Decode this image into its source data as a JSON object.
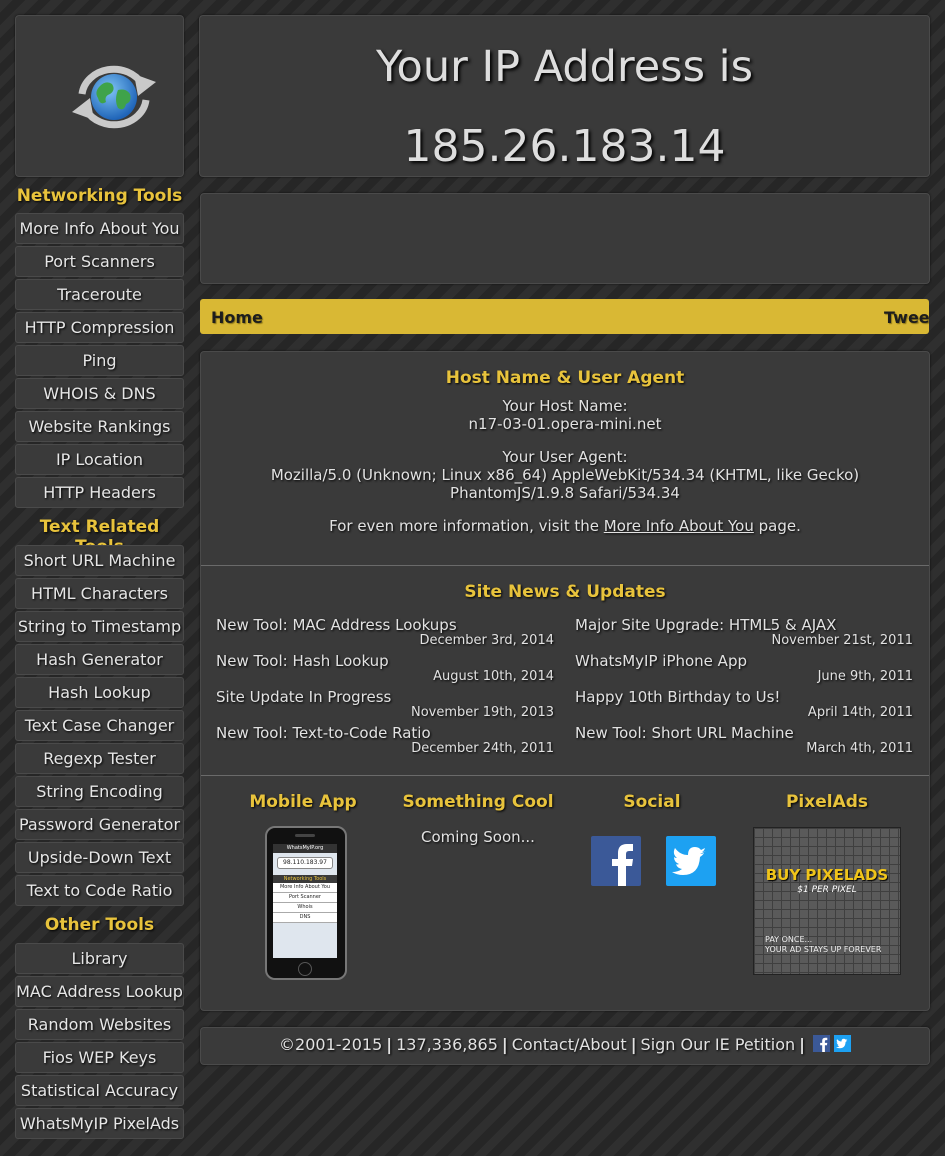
{
  "header": {
    "ip_title": "Your IP Address is",
    "ip_address": "185.26.183.14"
  },
  "sidebar": {
    "sections": [
      {
        "heading": "Networking Tools",
        "items": [
          "More Info About You",
          "Port Scanners",
          "Traceroute",
          "HTTP Compression",
          "Ping",
          "WHOIS & DNS",
          "Website Rankings",
          "IP Location",
          "HTTP Headers"
        ]
      },
      {
        "heading": "Text Related Tools",
        "items": [
          "Short URL Machine",
          "HTML Characters",
          "String to Timestamp",
          "Hash Generator",
          "Hash Lookup",
          "Text Case Changer",
          "Regexp Tester",
          "String Encoding",
          "Password Generator",
          "Upside-Down Text",
          "Text to Code Ratio"
        ]
      },
      {
        "heading": "Other Tools",
        "items": [
          "Library",
          "MAC Address Lookup",
          "Random Websites",
          "Fios WEP Keys",
          "Statistical Accuracy",
          "WhatsMyIP PixelAds"
        ]
      }
    ]
  },
  "nav": {
    "home": "Home",
    "tweet": "Tweet"
  },
  "host": {
    "title": "Host Name & User Agent",
    "host_label": "Your Host Name:",
    "host_value": "n17-03-01.opera-mini.net",
    "ua_label": "Your User Agent:",
    "ua_line1": "Mozilla/5.0 (Unknown; Linux x86_64) AppleWebKit/534.34 (KHTML, like Gecko)",
    "ua_line2": "PhantomJS/1.9.8 Safari/534.34",
    "more_prefix": "For even more information, visit the",
    "more_link": "More Info About You",
    "more_suffix": "page."
  },
  "news": {
    "title": "Site News & Updates",
    "left": [
      {
        "title": "New Tool: MAC Address Lookups",
        "date": "December 3rd, 2014"
      },
      {
        "title": "New Tool: Hash Lookup",
        "date": "August 10th, 2014"
      },
      {
        "title": "Site Update In Progress",
        "date": "November 19th, 2013"
      },
      {
        "title": "New Tool: Text-to-Code Ratio",
        "date": "December 24th, 2011"
      }
    ],
    "right": [
      {
        "title": "Major Site Upgrade: HTML5 & AJAX",
        "date": "November 21st, 2011"
      },
      {
        "title": "WhatsMyIP iPhone App",
        "date": "June 9th, 2011"
      },
      {
        "title": "Happy 10th Birthday to Us!",
        "date": "April 14th, 2011"
      },
      {
        "title": "New Tool: Short URL Machine",
        "date": "March 4th, 2011"
      }
    ]
  },
  "bottom": {
    "mobile_title": "Mobile App",
    "cool_title": "Something Cool",
    "cool_text": "Coming Soon...",
    "social_title": "Social",
    "pixel_title": "PixelAds",
    "pixel_headline": "BUY PIXELADS",
    "pixel_sub": "$1 PER PIXEL",
    "pixel_line1": "PAY ONCE...",
    "pixel_line2": "YOUR AD STAYS UP FOREVER",
    "phone_screen": {
      "title": "WhatsMyIP.org",
      "ip": "98.110.183.97",
      "heading": "Networking Tools",
      "items": [
        "More Info About You",
        "Port Scanner",
        "Whois",
        "DNS"
      ]
    }
  },
  "footer": {
    "copyright": "©2001-2015",
    "count": "137,336,865",
    "contact": "Contact/About",
    "petition": "Sign Our IE Petition"
  },
  "colors": {
    "accent": "#d9b834",
    "heading": "#e8c33c",
    "facebook": "#3b5998",
    "twitter": "#1da1f2"
  },
  "icons": [
    "globe-refresh-icon",
    "facebook-icon",
    "twitter-icon"
  ]
}
